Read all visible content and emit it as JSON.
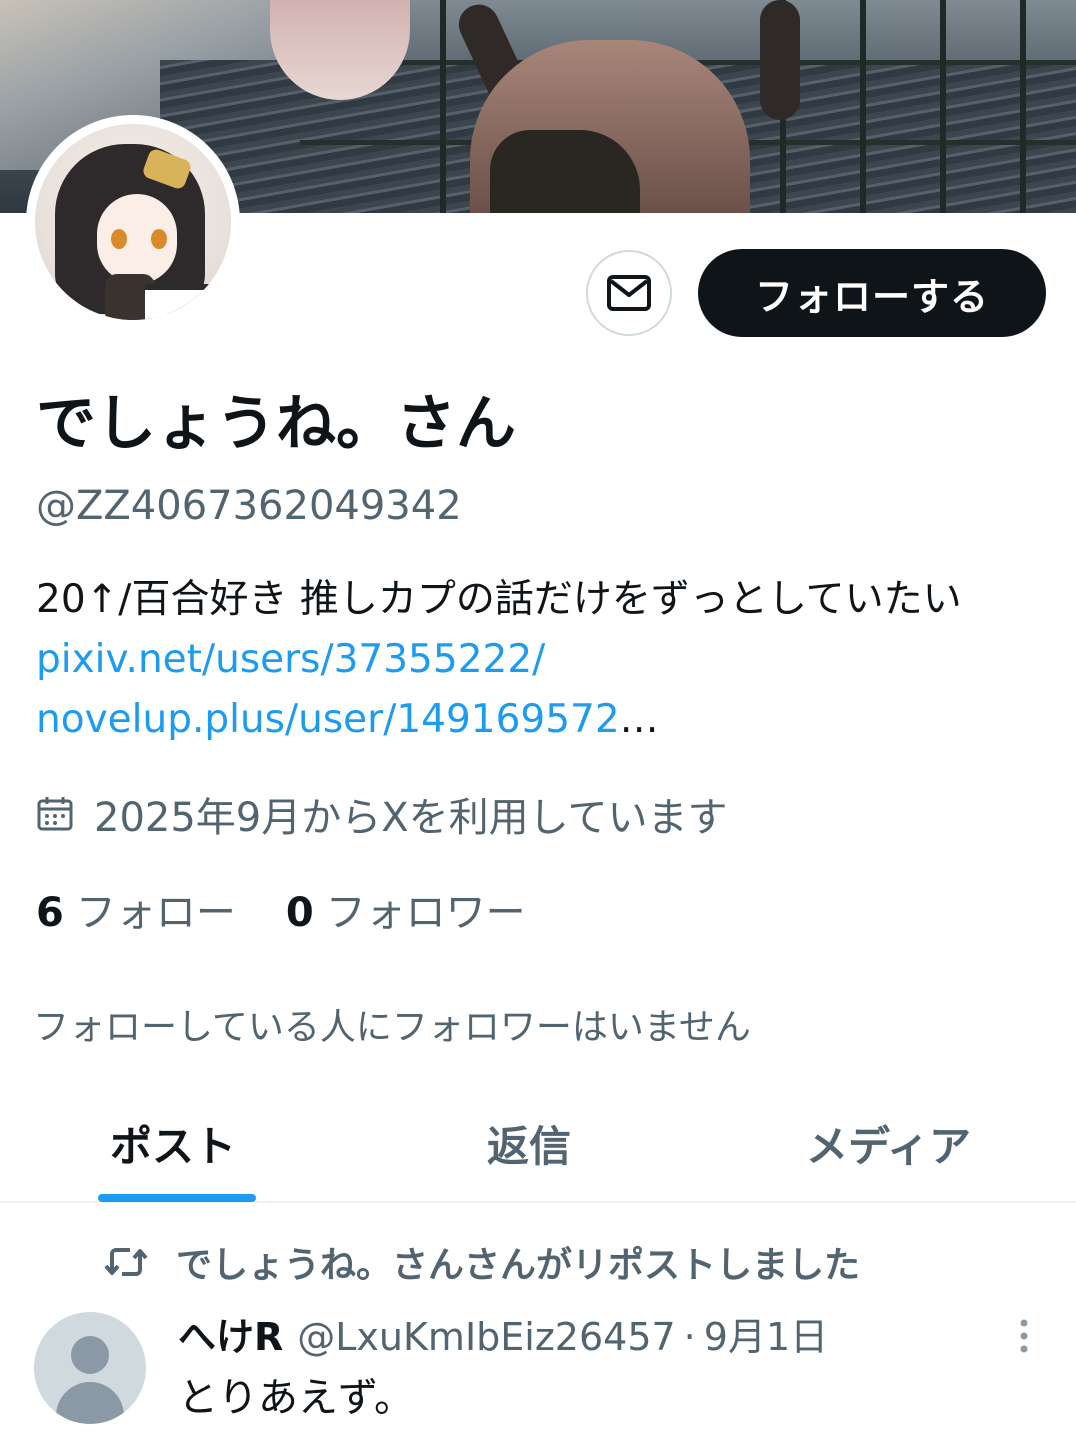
{
  "profile": {
    "display_name": "でしょうね。さん",
    "handle": "@ZZ4067362049342",
    "bio_text": "20↑/百合好き 推しカプの話だけをずっとしていたい ",
    "bio_link_1": "pixiv.net/users/37355222/",
    "bio_link_2": "novelup.plus/user/149169572",
    "bio_ellipsis": "…",
    "joined": "2025年9月からXを利用しています",
    "following_count": "6",
    "following_label": "フォロー",
    "followers_count": "0",
    "followers_label": "フォロワー",
    "followed_by_note": "フォローしている人にフォロワーはいません"
  },
  "actions": {
    "follow_label": "フォローする",
    "message_icon": "mail-icon"
  },
  "tabs": [
    {
      "label": "ポスト",
      "active": true
    },
    {
      "label": "返信",
      "active": false
    },
    {
      "label": "メディア",
      "active": false
    }
  ],
  "timeline": {
    "repost_note": "でしょうね。さんさんがリポストしました",
    "post": {
      "author_name": "へけR",
      "author_handle": "@LxuKmIbEiz26457",
      "separator": "·",
      "date": "9月1日",
      "text": "とりあえず。"
    }
  },
  "colors": {
    "accent": "#1d9bf0",
    "text_primary": "#0f1419",
    "text_secondary": "#536471",
    "follow_button_bg": "#0f1419"
  }
}
